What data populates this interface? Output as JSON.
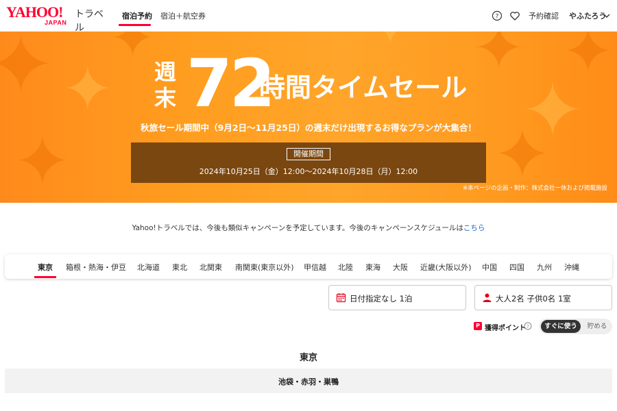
{
  "header": {
    "logo_main": "YAHOO!",
    "logo_sub": "JAPAN",
    "logo_service": "トラベル",
    "tabs": [
      {
        "label": "宿泊予約",
        "active": true
      },
      {
        "label": "宿泊＋航空券",
        "active": false
      }
    ],
    "help_icon": "help-circle-icon",
    "favorite_icon": "heart-icon",
    "reservation_label": "予約確認",
    "user_name": "やふたろう",
    "accent_color": "#ff0033"
  },
  "banner": {
    "headline_small_1": "週",
    "headline_small_2": "末",
    "headline_number": "72",
    "headline_rest": "時間タイムセール",
    "subline": "秋旅セール期間中（9月2日〜11月25日）の週末だけ出現するお得なプランが大集合！",
    "period_label": "開催期間",
    "period_dates": "2024年10月25日（金）12:00〜2024年10月28日（月）12:00",
    "note": "※本ページの企画・制作：株式会社一休および掲載施設",
    "background_color": "#ff9a20",
    "period_box_color": "#7a4710"
  },
  "notice": {
    "text": "Yahoo!トラベルでは、今後も類似キャンペーンを予定しています。今後のキャンペーンスケジュールは",
    "link": "こちら"
  },
  "regions": [
    {
      "label": "東京",
      "active": true
    },
    {
      "label": "箱根・熱海・伊豆",
      "active": false
    },
    {
      "label": "北海道",
      "active": false
    },
    {
      "label": "東北",
      "active": false
    },
    {
      "label": "北関東",
      "active": false
    },
    {
      "label": "南関東(東京以外)",
      "active": false
    },
    {
      "label": "甲信越",
      "active": false
    },
    {
      "label": "北陸",
      "active": false
    },
    {
      "label": "東海",
      "active": false
    },
    {
      "label": "大阪",
      "active": false
    },
    {
      "label": "近畿(大阪以外)",
      "active": false
    },
    {
      "label": "中国",
      "active": false
    },
    {
      "label": "四国",
      "active": false
    },
    {
      "label": "九州",
      "active": false
    },
    {
      "label": "沖縄",
      "active": false
    }
  ],
  "search": {
    "date_value": "日付指定なし 1泊",
    "date_icon": "calendar-icon",
    "guests_value": "大人2名 子供0名 1室",
    "guests_icon": "person-icon"
  },
  "points": {
    "label": "獲得ポイント",
    "icon_letter": "P",
    "option_use": "すぐに使う",
    "option_save": "貯める",
    "selected": "すぐに使う"
  },
  "section": {
    "title": "東京",
    "area": "池袋・赤羽・巣鴨"
  }
}
